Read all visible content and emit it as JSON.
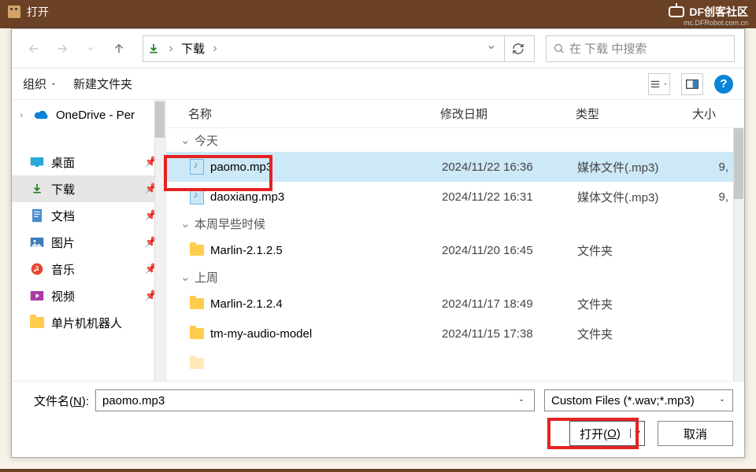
{
  "titlebar": {
    "title": "打开"
  },
  "brand": {
    "main": "DF创客社区",
    "sub": "mc.DFRobot.com.cn"
  },
  "nav": {
    "crumb": "下载",
    "search_placeholder": "在 下载 中搜索"
  },
  "toolbar": {
    "organize": "组织",
    "new_folder": "新建文件夹"
  },
  "sidebar": {
    "onedrive": "OneDrive - Per",
    "items": [
      {
        "label": "桌面"
      },
      {
        "label": "下载"
      },
      {
        "label": "文档"
      },
      {
        "label": "图片"
      },
      {
        "label": "音乐"
      },
      {
        "label": "视频"
      },
      {
        "label": "单片机机器人"
      }
    ]
  },
  "columns": {
    "name": "名称",
    "date": "修改日期",
    "type": "类型",
    "size": "大小"
  },
  "groups": {
    "today": "今天",
    "earlier_week": "本周早些时候",
    "last_week": "上周"
  },
  "files": [
    {
      "name": "paomo.mp3",
      "date": "2024/11/22 16:36",
      "type": "媒体文件(.mp3)",
      "size": "9,"
    },
    {
      "name": "daoxiang.mp3",
      "date": "2024/11/22 16:31",
      "type": "媒体文件(.mp3)",
      "size": "9,"
    },
    {
      "name": "Marlin-2.1.2.5",
      "date": "2024/11/20 16:45",
      "type": "文件夹",
      "size": ""
    },
    {
      "name": "Marlin-2.1.2.4",
      "date": "2024/11/17 18:49",
      "type": "文件夹",
      "size": ""
    },
    {
      "name": "tm-my-audio-model",
      "date": "2024/11/15 17:38",
      "type": "文件夹",
      "size": ""
    }
  ],
  "footer": {
    "filename_label_pre": "文件名(",
    "filename_label_key": "N",
    "filename_label_post": "):",
    "filename_value": "paomo.mp3",
    "filter": "Custom Files (*.wav;*.mp3)",
    "open_pre": "打开(",
    "open_key": "O",
    "open_post": ")",
    "cancel": "取消"
  },
  "chart_data": null
}
